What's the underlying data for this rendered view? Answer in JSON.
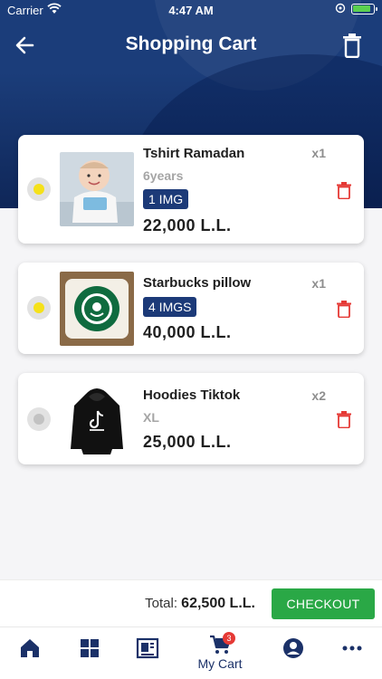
{
  "status_bar": {
    "carrier": "Carrier",
    "time": "4:47 AM"
  },
  "header": {
    "title": "Shopping Cart",
    "back_icon": "arrow-left-icon",
    "clear_icon": "trash-icon"
  },
  "items": [
    {
      "name": "Tshirt Ramadan",
      "qty": "x1",
      "variant": "6years",
      "badge": "1 IMG",
      "price": "22,000 L.L.",
      "selected": true
    },
    {
      "name": "Starbucks pillow",
      "qty": "x1",
      "badge": "4 IMGS",
      "price": "40,000 L.L.",
      "selected": true
    },
    {
      "name": "Hoodies Tiktok",
      "qty": "x2",
      "variant": "XL",
      "price": "25,000 L.L.",
      "selected": false
    }
  ],
  "footer": {
    "total_label": "Total:",
    "total_value": "62,500 L.L.",
    "checkout_label": "CHECKOUT"
  },
  "tabbar": {
    "cart_label": "My Cart",
    "cart_count": "3"
  },
  "colors": {
    "header_bg": "#1b3d7a",
    "badge_bg": "#1c3a78",
    "checkout_bg": "#2aa846",
    "delete": "#e53935",
    "selected_dot": "#f5e11a"
  }
}
